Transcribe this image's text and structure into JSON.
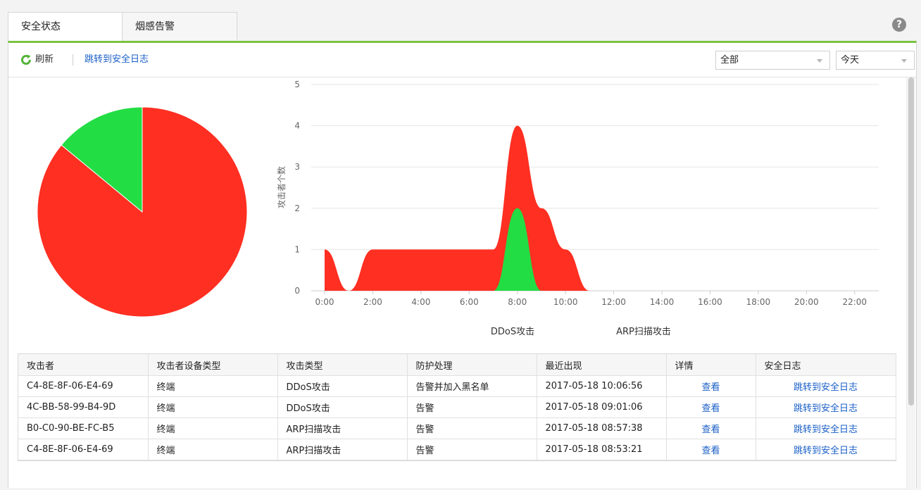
{
  "tabs": [
    {
      "label": "安全状态",
      "active": true
    },
    {
      "label": "烟感告警",
      "active": false
    }
  ],
  "help": {
    "icon": "help-icon",
    "label": "?"
  },
  "toolbar": {
    "refresh_label": "刷新",
    "refresh_icon": "refresh-icon",
    "log_link": "跳转到安全日志",
    "filter_type": {
      "selected": "全部"
    },
    "filter_time": {
      "selected": "今天"
    }
  },
  "colors": {
    "accent": "#7cc242",
    "ddos": "#ff2f22",
    "arp": "#22dd44",
    "link": "#1a5fc7"
  },
  "chart_data": [
    {
      "type": "pie",
      "series": [
        {
          "name": "DDoS攻击",
          "value": 0.86,
          "color": "#ff2f22"
        },
        {
          "name": "ARP扫描攻击",
          "value": 0.14,
          "color": "#22dd44"
        }
      ]
    },
    {
      "type": "area",
      "ylabel": "攻击者个数",
      "ylim": [
        0,
        5
      ],
      "yticks": [
        "0",
        "1",
        "2",
        "3",
        "4",
        "5"
      ],
      "xlim": [
        0,
        23
      ],
      "xticks": [
        "0:00",
        "2:00",
        "4:00",
        "6:00",
        "8:00",
        "10:00",
        "12:00",
        "14:00",
        "16:00",
        "18:00",
        "20:00",
        "22:00"
      ],
      "grid": true,
      "legend_position": "bottom",
      "series": [
        {
          "name": "DDoS攻击",
          "color": "#ff2f22",
          "x": [
            0,
            1,
            2,
            3,
            4,
            5,
            6,
            7,
            8,
            9,
            10,
            11
          ],
          "values": [
            1,
            0,
            1,
            1,
            1,
            1,
            1,
            1,
            4,
            2,
            1,
            0
          ]
        },
        {
          "name": "ARP扫描攻击",
          "color": "#22dd44",
          "x": [
            7,
            8,
            9
          ],
          "values": [
            0,
            2,
            0
          ]
        }
      ]
    }
  ],
  "table": {
    "headers": [
      "攻击者",
      "攻击者设备类型",
      "攻击类型",
      "防护处理",
      "最近出现",
      "详情",
      "安全日志"
    ],
    "rows": [
      [
        "C4-8E-8F-06-E4-69",
        "终端",
        "DDoS攻击",
        "告警并加入黑名单",
        "2017-05-18 10:06:56",
        "查看",
        "跳转到安全日志"
      ],
      [
        "4C-BB-58-99-B4-9D",
        "终端",
        "DDoS攻击",
        "告警",
        "2017-05-18 09:01:06",
        "查看",
        "跳转到安全日志"
      ],
      [
        "B0-C0-90-BE-FC-B5",
        "终端",
        "ARP扫描攻击",
        "告警",
        "2017-05-18 08:57:38",
        "查看",
        "跳转到安全日志"
      ],
      [
        "C4-8E-8F-06-E4-69",
        "终端",
        "ARP扫描攻击",
        "告警",
        "2017-05-18 08:53:21",
        "查看",
        "跳转到安全日志"
      ]
    ]
  }
}
